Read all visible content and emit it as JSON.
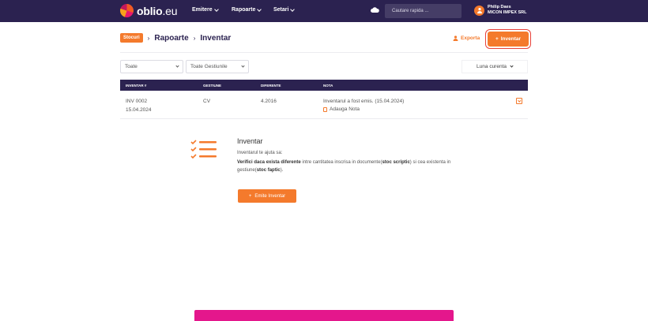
{
  "app": {
    "logo_main": "oblio",
    "logo_suffix": ".eu"
  },
  "nav": {
    "items": [
      {
        "label": "Emitere"
      },
      {
        "label": "Rapoarte"
      },
      {
        "label": "Setari"
      }
    ],
    "search_placeholder": "Cautare rapida ...",
    "user_name": "Philip Daes",
    "company": "MICON IMPEX SRL"
  },
  "header": {
    "badge": "Stocuri",
    "crumb1": "Rapoarte",
    "crumb2": "Inventar",
    "export_label": "Exporta",
    "add_label": "Inventar"
  },
  "filters": {
    "filter1": "Toate",
    "filter2": "Toate Gestiunile",
    "period": "Luna curenta"
  },
  "table": {
    "headers": [
      "INVENTAR #",
      "GESTIUNE",
      "DIFERENTE",
      "NOTA"
    ],
    "rows": [
      {
        "number": "INV 0002",
        "date": "15.04.2024",
        "gestiune": "CV",
        "diferente": "4.2016",
        "nota": "Inventarul a fost emis. (15.04.2024)",
        "add_note": "Adauga Nota"
      }
    ]
  },
  "info": {
    "title": "Inventar",
    "line1": "Inventarul te ajuta sa:",
    "line2_bold1": "Verifici daca exista diferente",
    "line2_text1": " intre cantitatea inscrisa in documente(",
    "line2_bold2": "stoc scriptic",
    "line2_text2": ") si cea existenta in gestiune(",
    "line2_bold3": "stoc faptic",
    "line2_text3": ").",
    "button": "Emite Inventar"
  },
  "colors": {
    "navbar": "#2b2250",
    "accent": "#f47a2c",
    "pink": "#e4178c"
  }
}
